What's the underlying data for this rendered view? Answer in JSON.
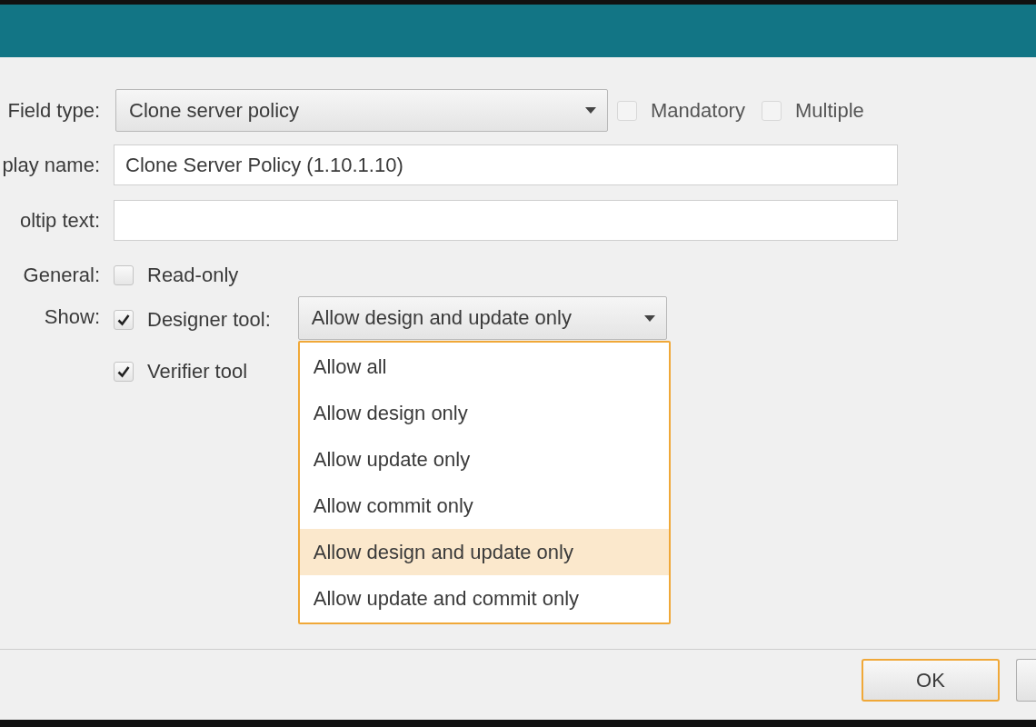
{
  "fields": [
    {
      "label": "Field type:",
      "kind": "dropdown",
      "value": "Clone server policy",
      "checks": [
        {
          "label": "Mandatory",
          "checked": false
        },
        {
          "label": "Multiple",
          "checked": false
        }
      ]
    },
    {
      "label": "play name:",
      "kind": "text",
      "value": "Clone Server Policy (1.10.1.10)"
    },
    {
      "label": "oltip text:",
      "kind": "text"
    }
  ],
  "general": {
    "label": "General:",
    "options": [
      {
        "label": "Read-only",
        "checked": false
      }
    ]
  },
  "show": {
    "label": "Show:",
    "designer": {
      "label": "Designer tool:",
      "checked": true,
      "value": "Allow design and update only",
      "expanded": true,
      "options": [
        {
          "label": "Allow all",
          "selected": false
        },
        {
          "label": "Allow design only",
          "selected": false
        },
        {
          "label": "Allow update only",
          "selected": false
        },
        {
          "label": "Allow commit only",
          "selected": false
        },
        {
          "label": "Allow design and update only",
          "selected": true
        },
        {
          "label": "Allow update and commit only",
          "selected": false
        }
      ]
    },
    "verifier": {
      "label": "Verifier tool",
      "checked": true
    }
  },
  "buttons": [
    {
      "label": "OK",
      "focused": true
    },
    {
      "focused": false
    }
  ]
}
